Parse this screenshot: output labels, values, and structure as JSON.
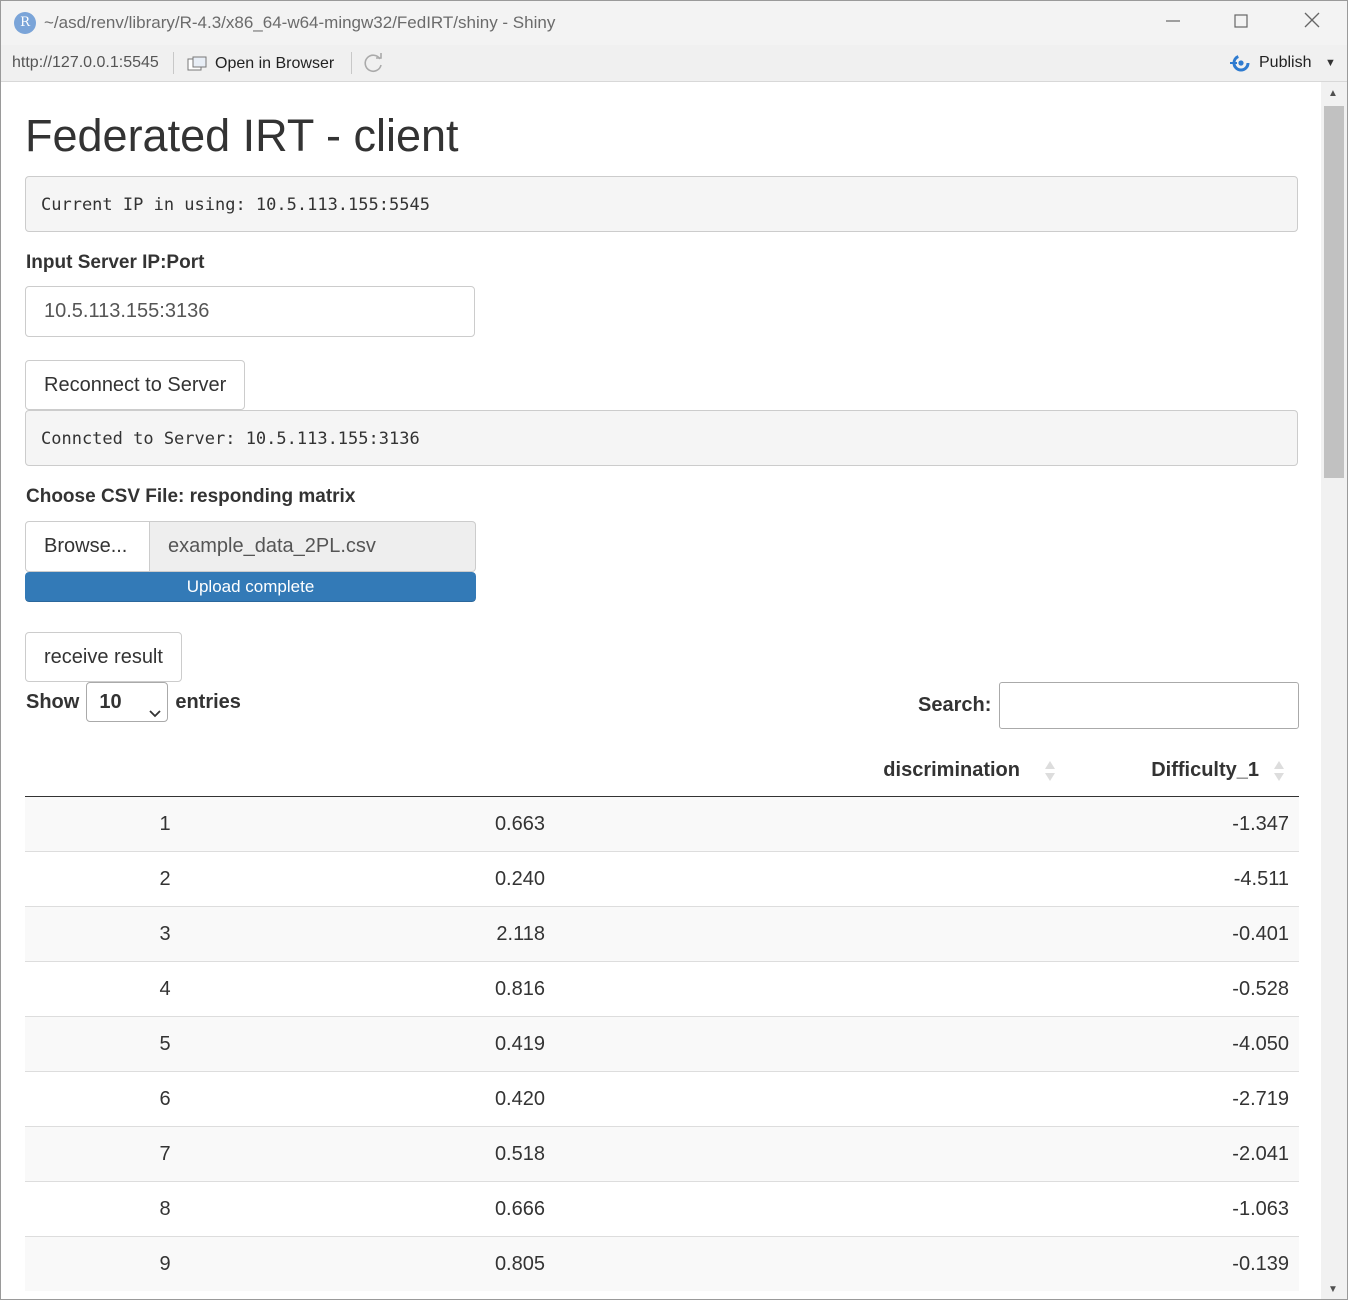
{
  "window": {
    "title": "~/asd/renv/library/R-4.3/x86_64-w64-mingw32/FedIRT/shiny - Shiny",
    "logo_letter": "R"
  },
  "toolbar": {
    "url": "http://127.0.0.1:5545",
    "open_in_browser": "Open in Browser",
    "publish": "Publish"
  },
  "page": {
    "title": "Federated IRT - client",
    "current_ip": "Current IP in using: 10.5.113.155:5545",
    "server_label": "Input Server IP:Port",
    "server_value": "10.5.113.155:3136",
    "reconnect_label": "Reconnect to Server",
    "connected_status": "Conncted to Server: 10.5.113.155:3136",
    "csv_label": "Choose CSV File: responding matrix",
    "browse_label": "Browse...",
    "file_name": "example_data_2PL.csv",
    "upload_status": "Upload complete",
    "upload_progress": 1.0,
    "receive_label": "receive result"
  },
  "table_controls": {
    "show_label": "Show",
    "entries_value": "10",
    "entries_label": "entries",
    "search_label": "Search:",
    "search_value": ""
  },
  "table": {
    "columns": [
      "",
      "discrimination",
      "Difficulty_1"
    ],
    "rows": [
      [
        "1",
        "0.663",
        "-1.347"
      ],
      [
        "2",
        "0.240",
        "-4.511"
      ],
      [
        "3",
        "2.118",
        "-0.401"
      ],
      [
        "4",
        "0.816",
        "-0.528"
      ],
      [
        "5",
        "0.419",
        "-4.050"
      ],
      [
        "6",
        "0.420",
        "-2.719"
      ],
      [
        "7",
        "0.518",
        "-2.041"
      ],
      [
        "8",
        "0.666",
        "-1.063"
      ],
      [
        "9",
        "0.805",
        "-0.139"
      ]
    ]
  },
  "colors": {
    "progress": "#337ab7",
    "publish_icon": "#2e7bd0"
  }
}
